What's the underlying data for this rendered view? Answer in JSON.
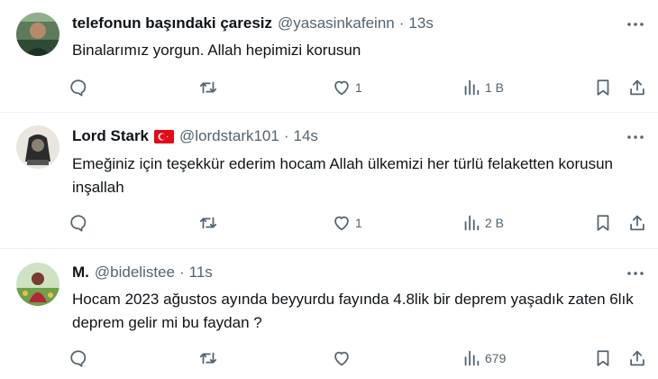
{
  "tweets": [
    {
      "name": "telefonun başındaki çaresiz",
      "handle": "@yasasinkafeinn",
      "separator": "·",
      "time": "13s",
      "text": "Binalarımız yorgun. Allah hepimizi korusun",
      "likes": "1",
      "views": "1 B",
      "flag": false
    },
    {
      "name": "Lord Stark",
      "handle": "@lordstark101",
      "separator": "·",
      "time": "14s",
      "text": "Emeğiniz için teşekkür ederim hocam Allah ülkemizi her türlü felaketten korusun inşallah",
      "likes": "1",
      "views": "2 B",
      "flag": true
    },
    {
      "name": "M.",
      "handle": "@bidelistee",
      "separator": "·",
      "time": "11s",
      "text": "Hocam 2023 ağustos ayında beyyurdu fayında 4.8lik bir deprem yaşadık zaten 6lık deprem gelir mi bu faydan ?",
      "likes": "",
      "views": "679",
      "flag": false
    }
  ],
  "icons": {
    "reply": "reply-icon",
    "retweet": "retweet-icon",
    "like": "heart-icon",
    "views": "views-icon",
    "bookmark": "bookmark-icon",
    "share": "share-icon",
    "more": "more-icon",
    "flag": "turkey-flag-icon"
  },
  "colors": {
    "text": "#0f1419",
    "secondary": "#536471",
    "divider": "#eff3f4",
    "flag_red": "#e30a17"
  }
}
